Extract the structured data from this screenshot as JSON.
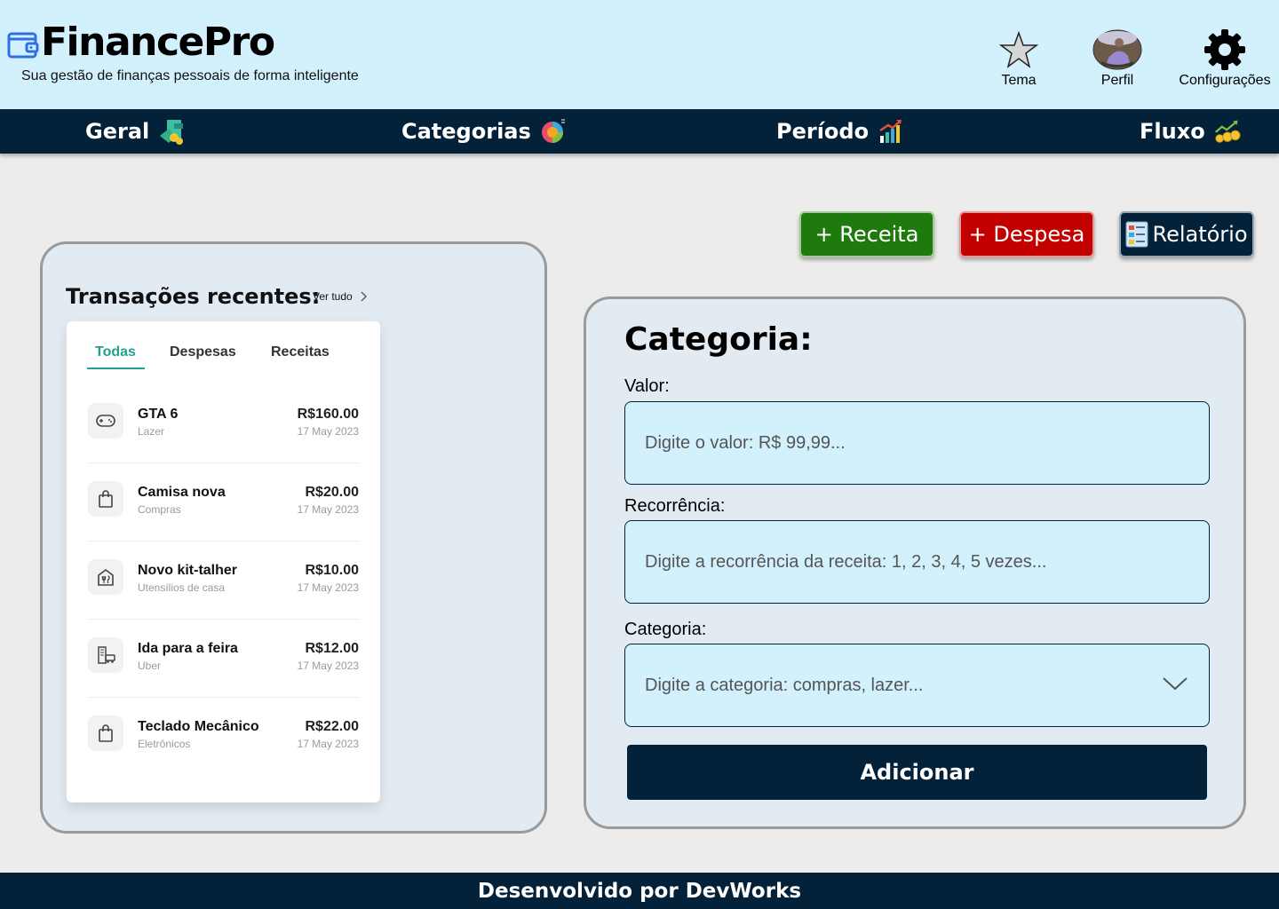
{
  "app": {
    "name": "FinancePro",
    "tagline": "Sua gestão de finanças pessoais de forma inteligente"
  },
  "top_actions": [
    {
      "label": "Tema",
      "icon": "star-icon"
    },
    {
      "label": "Perfil",
      "icon": "avatar"
    },
    {
      "label": "Configurações",
      "icon": "gear-icon"
    }
  ],
  "nav": [
    {
      "label": "Geral",
      "icon": "money-stack-icon"
    },
    {
      "label": "Categorias",
      "icon": "pie-chart-icon"
    },
    {
      "label": "Período",
      "icon": "bar-chart-icon"
    },
    {
      "label": "Fluxo",
      "icon": "growth-coins-icon"
    }
  ],
  "actions": {
    "income": "+ Receita",
    "expense": "+ Despesa",
    "report": "Relatório"
  },
  "recent": {
    "title": "Transações recentes:",
    "see_all": "Ver tudo",
    "tabs": [
      "Todas",
      "Despesas",
      "Receitas"
    ],
    "active_tab": "Todas",
    "transactions": [
      {
        "name": "GTA 6",
        "category": "Lazer",
        "amount": "R$160.00",
        "date": "17 May 2023",
        "icon": "gamepad-icon"
      },
      {
        "name": "Camisa nova",
        "category": "Compras",
        "amount": "R$20.00",
        "date": "17 May 2023",
        "icon": "shopping-bag-icon"
      },
      {
        "name": "Novo kit-talher",
        "category": "Utensílios de casa",
        "amount": "R$10.00",
        "date": "17 May 2023",
        "icon": "house-cutlery-icon"
      },
      {
        "name": "Ida para a feira",
        "category": "Uber",
        "amount": "R$12.00",
        "date": "17 May 2023",
        "icon": "city-car-icon"
      },
      {
        "name": "Teclado Mecânico",
        "category": "Eletrônicos",
        "amount": "R$22.00",
        "date": "17 May 2023",
        "icon": "shopping-bag-icon"
      }
    ]
  },
  "form": {
    "title": "Categoria:",
    "value_label": "Valor:",
    "value_placeholder": "Digite o valor: R$ 99,99...",
    "recurrence_label": "Recorrência:",
    "recurrence_placeholder": "Digite a recorrência da receita: 1, 2, 3, 4, 5 vezes...",
    "category_label": "Categoria:",
    "category_placeholder": "Digite a categoria: compras, lazer...",
    "submit": "Adicionar"
  },
  "footer": "Desenvolvido por DevWorks",
  "colors": {
    "header_bg": "#d3f1fd",
    "nav_bg": "#03223a",
    "income": "#1e7a0c",
    "expense": "#c20000",
    "report": "#03223a",
    "accent": "#22a08d"
  }
}
